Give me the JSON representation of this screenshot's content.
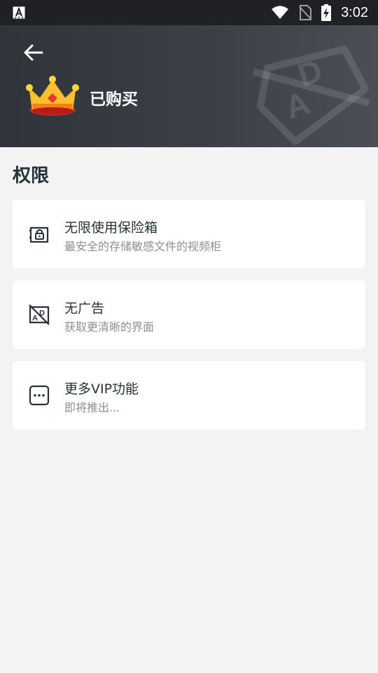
{
  "status_bar": {
    "time": "3:02",
    "icons": [
      "a-notification-icon",
      "wifi-icon",
      "no-sim-icon",
      "battery-charging-icon"
    ]
  },
  "header": {
    "back_icon": "arrow-left-icon",
    "crown_icon": "crown-icon",
    "title": "已购买",
    "background_colors": [
      "#2f343b",
      "#4a4f56"
    ]
  },
  "section": {
    "title": "权限"
  },
  "features": [
    {
      "icon": "vault-lock-icon",
      "title": "无限使用保险箱",
      "subtitle": "最安全的存储敏感文件的视频柜"
    },
    {
      "icon": "no-ads-icon",
      "title": "无广告",
      "subtitle": "获取更清晰的界面"
    },
    {
      "icon": "more-dots-icon",
      "title": "更多VIP功能",
      "subtitle": "即将推出..."
    }
  ],
  "colors": {
    "text_primary": "#263238",
    "text_secondary": "#8a8f95",
    "background": "#f3f3f3",
    "card": "#ffffff"
  }
}
